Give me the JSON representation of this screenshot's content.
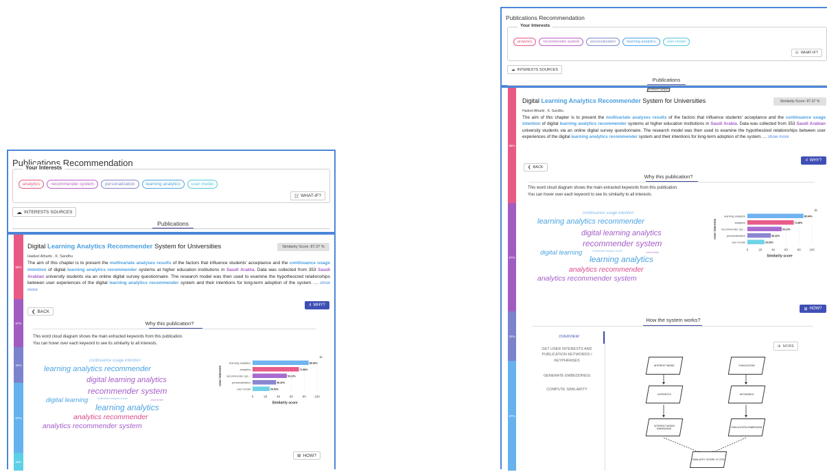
{
  "title": "Publications Recommendation",
  "interests_label": "Your Interests",
  "interests": [
    {
      "label": "analytics",
      "color": "#e5587e"
    },
    {
      "label": "recommender system",
      "color": "#b55fc4"
    },
    {
      "label": "personalization",
      "color": "#7c86c7"
    },
    {
      "label": "learning analytics",
      "color": "#4ca3e0"
    },
    {
      "label": "user model",
      "color": "#51c7d9"
    }
  ],
  "whatif_label": "WHAT-IF?",
  "sources_label": "INTERESTS SOURCES",
  "tab_label": "Publications",
  "pub": {
    "title_pre": "Digital ",
    "title_hl": "Learning Analytics Recommender",
    "title_post": " System for Universities",
    "similarity": "Similarity Score: 87.37 %",
    "authors": "Hadeel Alharbi , K. Sandhu",
    "abs_1": "The aim of this chapter is to present the ",
    "abs_hl1": "multivariate analyses results",
    "abs_2": " of the factors that influence students' acceptance and the ",
    "abs_hl2": "continuance usage intention",
    "abs_3": " of digital ",
    "abs_hl3": "learning analytics recommender",
    "abs_4": " systems at higher education institutions in ",
    "abs_hl4": "Saudi Arabia",
    "abs_5": ". Data was collected from 353 ",
    "abs_hl5": "Saudi Arabian",
    "abs_6": " university students via an online digital survey questionnaire. The research model was then used to examine the hypothesized relationships between user experiences of the digital ",
    "abs_hl6": "learning analytics recommender",
    "abs_7": " system and their intentions for long-term adoption of the system. ...",
    "show_more": "show more"
  },
  "back_label": "BACK",
  "why_label": "WHY?",
  "why_title": "Why this publication?",
  "why_desc1": "This word cloud diagram shows the main extracted keywords from this publication.",
  "why_desc2": "You can hover over each keyword to see its similarity to all interests.",
  "wordcloud": [
    {
      "text": "continuance usage intention",
      "color": "#7fb8ea"
    },
    {
      "text": "learning analytics recommender",
      "color": "#4ca3e0"
    },
    {
      "text": "digital learning analytics",
      "color": "#a45bc8"
    },
    {
      "text": "recommender system",
      "color": "#a45bc8"
    },
    {
      "text": "digital learning",
      "color": "#4ca3e0"
    },
    {
      "text": "multivariate analyses results",
      "color": "#7fb8ea"
    },
    {
      "text": "saudi arabia",
      "color": "#b77fd3"
    },
    {
      "text": "learning analytics",
      "color": "#4ca3e0"
    },
    {
      "text": "analytics recommender",
      "color": "#d9488a"
    },
    {
      "text": "analytics recommender system",
      "color": "#a45bc8"
    }
  ],
  "chart_data": {
    "type": "bar",
    "orientation": "horizontal",
    "categories": [
      "learning analytics",
      "analytics",
      "recommender sys...",
      "personalization",
      "user model"
    ],
    "values": [
      86.94,
      71.86,
      53.12,
      36.42,
      26.52
    ],
    "labels": [
      "86.94%",
      "71.86%",
      "53.12%",
      "36.42%",
      "26.52%"
    ],
    "colors": [
      "#6fb3ef",
      "#e85c8a",
      "#a96bd0",
      "#8a86d0",
      "#6fd3e8"
    ],
    "xlabel": "Similarity score",
    "ylabel": "User interests",
    "xticks": [
      "0",
      "20",
      "40",
      "60",
      "80",
      "100"
    ],
    "xlim": [
      0,
      100
    ]
  },
  "how_label": "HOW?",
  "how_title": "How the system works?",
  "how_nav": [
    "OVERVIEW",
    "GET USER INTERESTS AND PUBLICATION KEYWORDS / KEYPHRASES",
    "GENERATE EMBEDDINGS",
    "COMPUTE SIMILARITY"
  ],
  "more_label": "MORE",
  "flow": {
    "interest_model": "INTEREST MODEL",
    "publication": "PUBLICATION",
    "interests": "INTERESTS",
    "keywords": "KEYWORDS",
    "interest_emb": "INTEREST MODEL EMBEDDING",
    "pub_emb": "PUBLICATION EMBEDDING",
    "similarity": "SIMILARITY SCORE: 87.37%"
  },
  "sidebar": [
    "88%",
    "67%",
    "32%",
    "67%",
    "28%"
  ]
}
